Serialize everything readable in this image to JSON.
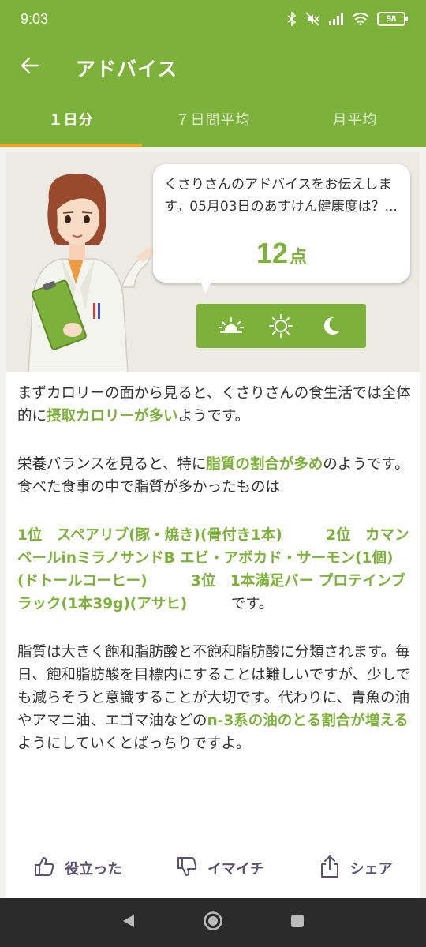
{
  "status": {
    "time": "9:03",
    "battery": "98",
    "icons": [
      "bluetooth-icon",
      "mute-icon",
      "signal-icon",
      "wifi-icon",
      "battery-icon"
    ]
  },
  "appbar": {
    "title": "アドバイス",
    "back_icon": "arrow-left-icon"
  },
  "tabs": [
    {
      "label": "１日分",
      "active": true
    },
    {
      "label": "７日間平均",
      "active": false
    },
    {
      "label": "月平均",
      "active": false
    }
  ],
  "bubble": {
    "text": "くさりさんのアドバイスをお伝えします。05月03日のあすけん健康度は？...",
    "score": "12",
    "score_unit": "点"
  },
  "time_icons": [
    "sunrise-icon",
    "sun-icon",
    "moon-icon"
  ],
  "advice": {
    "p1": {
      "pre": "まずカロリーの面から見ると、くさりさんの食生活では全体的に",
      "hl": "摂取カロリーが多い",
      "post": "ようです。"
    },
    "p2": {
      "pre": "栄養バランスを見ると、特に",
      "hl": "脂質の割合が多め",
      "post": "のようです。食べた食事の中で脂質が多かったものは"
    },
    "p3": {
      "hl": "1位　スペアリブ(豚・焼き)(骨付き1本)　　　2位　カマンベールinミラノサンドB エビ・アボカド・サーモン(1個)(ドトールコーヒー)　　　3位　1本満足バー プロテインブラック(1本39g)(アサヒ)　　　",
      "post": "です。"
    },
    "p4": {
      "pre": "脂質は大きく飽和脂肪酸と不飽和脂肪酸に分類されます。毎日、飽和脂肪酸を目標内にすることは難しいですが、少しでも減らそうと意識することが大切です。代わりに、青魚の油やアマニ油、エゴマ油などの",
      "hl": "n-3系の油のとる割合が増える",
      "post": "ようにしていくとばっちりですよ。"
    }
  },
  "actions": {
    "helpful": "役立った",
    "not_helpful": "イマイチ",
    "share": "シェア"
  },
  "colors": {
    "accent": "#7db23a",
    "tab_indicator": "#f5a623",
    "action_text": "#5a5270"
  }
}
